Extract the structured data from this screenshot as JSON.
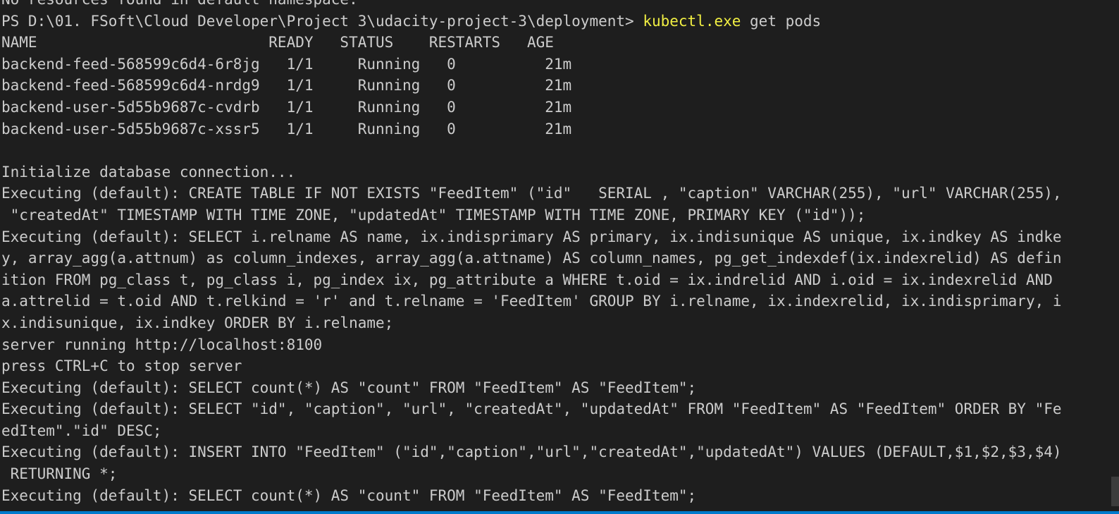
{
  "colors": {
    "background": "#1e1e1e",
    "text": "#cccccc",
    "command": "#f1ef43",
    "accent_bar": "#007acc",
    "scrollbar": "#3c3c3c"
  },
  "terminal": {
    "lines": [
      "No resources found in default namespace.",
      {
        "prompt": "PS D:\\01. FSoft\\Cloud Developer\\Project 3\\udacity-project-3\\deployment> ",
        "command": "kubectl.exe",
        "args": " get pods"
      },
      "NAME                          READY   STATUS    RESTARTS   AGE",
      "backend-feed-568599c6d4-6r8jg   1/1     Running   0          21m",
      "backend-feed-568599c6d4-nrdg9   1/1     Running   0          21m",
      "backend-user-5d55b9687c-cvdrb   1/1     Running   0          21m",
      "backend-user-5d55b9687c-xssr5   1/1     Running   0          21m",
      "",
      "Initialize database connection...",
      "Executing (default): CREATE TABLE IF NOT EXISTS \"FeedItem\" (\"id\"   SERIAL , \"caption\" VARCHAR(255), \"url\" VARCHAR(255),",
      " \"createdAt\" TIMESTAMP WITH TIME ZONE, \"updatedAt\" TIMESTAMP WITH TIME ZONE, PRIMARY KEY (\"id\"));",
      "Executing (default): SELECT i.relname AS name, ix.indisprimary AS primary, ix.indisunique AS unique, ix.indkey AS indke",
      "y, array_agg(a.attnum) as column_indexes, array_agg(a.attname) AS column_names, pg_get_indexdef(ix.indexrelid) AS defin",
      "ition FROM pg_class t, pg_class i, pg_index ix, pg_attribute a WHERE t.oid = ix.indrelid AND i.oid = ix.indexrelid AND",
      "a.attrelid = t.oid AND t.relkind = 'r' and t.relname = 'FeedItem' GROUP BY i.relname, ix.indexrelid, ix.indisprimary, i",
      "x.indisunique, ix.indkey ORDER BY i.relname;",
      "server running http://localhost:8100",
      "press CTRL+C to stop server",
      "Executing (default): SELECT count(*) AS \"count\" FROM \"FeedItem\" AS \"FeedItem\";",
      "Executing (default): SELECT \"id\", \"caption\", \"url\", \"createdAt\", \"updatedAt\" FROM \"FeedItem\" AS \"FeedItem\" ORDER BY \"Fe",
      "edItem\".\"id\" DESC;",
      "Executing (default): INSERT INTO \"FeedItem\" (\"id\",\"caption\",\"url\",\"createdAt\",\"updatedAt\") VALUES (DEFAULT,$1,$2,$3,$4)",
      " RETURNING *;",
      "Executing (default): SELECT count(*) AS \"count\" FROM \"FeedItem\" AS \"FeedItem\";"
    ]
  }
}
